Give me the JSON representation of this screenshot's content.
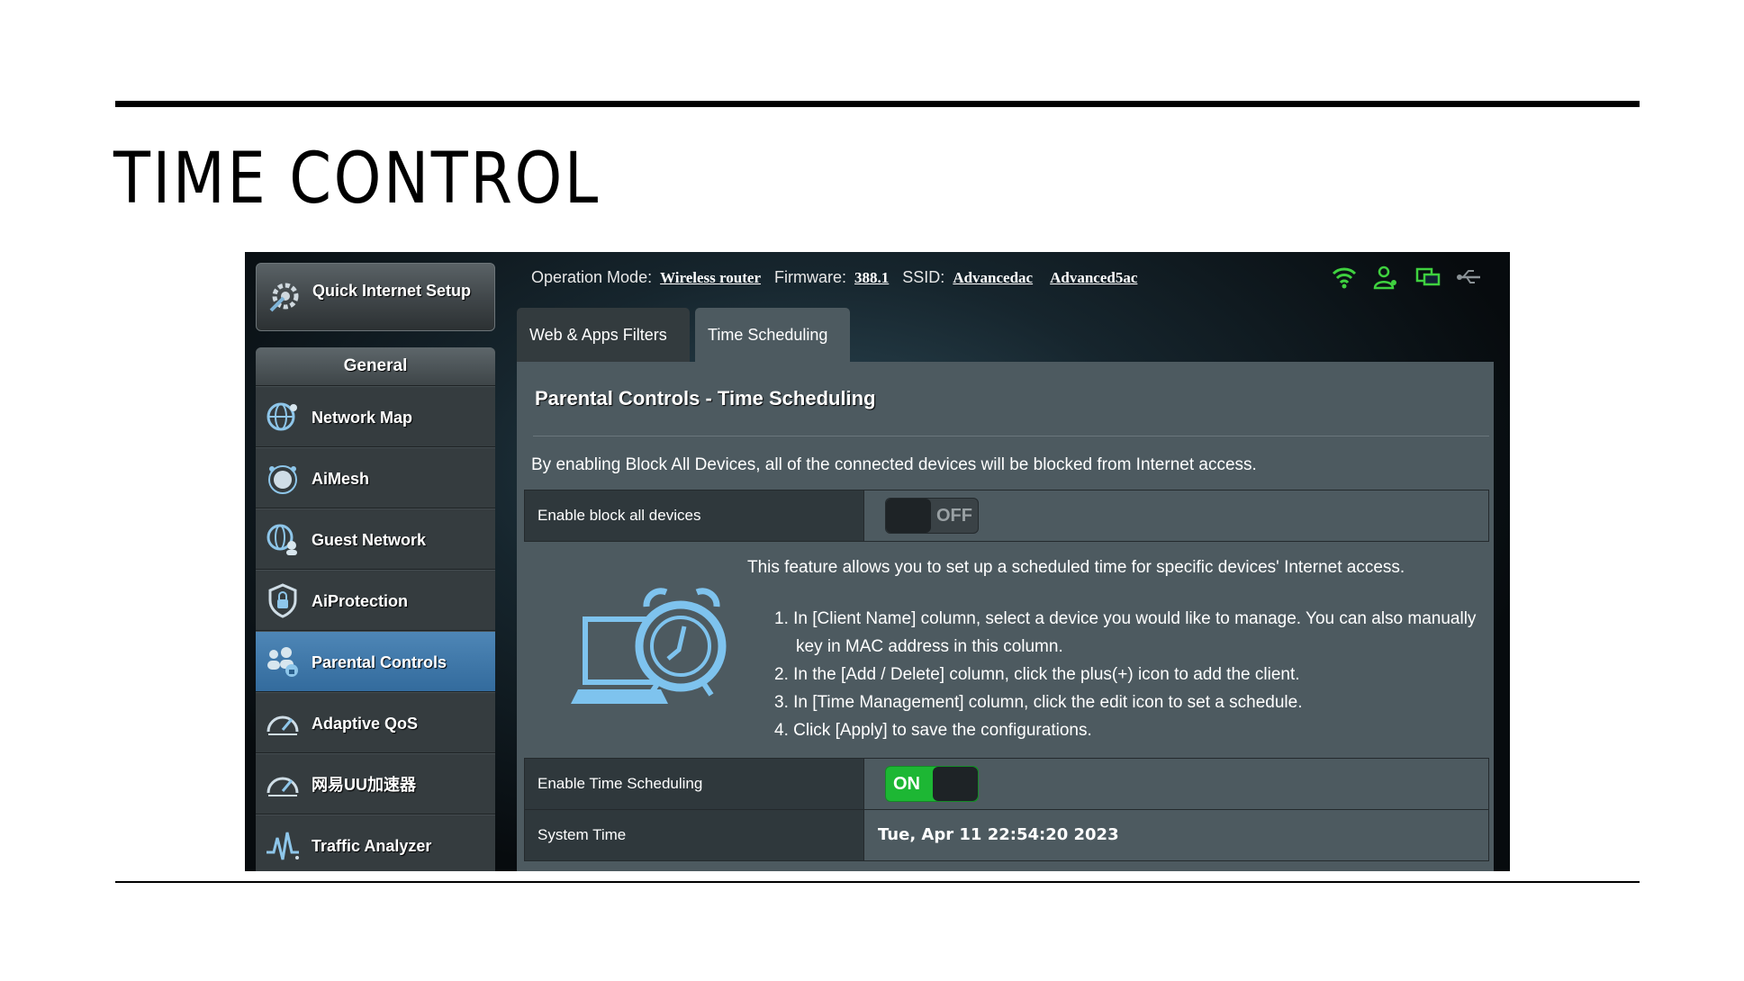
{
  "slide": {
    "title": "TIME CONTROL"
  },
  "sidebar": {
    "quick_setup": "Quick Internet Setup",
    "section": "General",
    "items": [
      {
        "label": "Network Map",
        "icon": "globe-network-icon"
      },
      {
        "label": "AiMesh",
        "icon": "aimesh-icon"
      },
      {
        "label": "Guest Network",
        "icon": "guest-network-icon"
      },
      {
        "label": "AiProtection",
        "icon": "shield-lock-icon"
      },
      {
        "label": "Parental Controls",
        "icon": "family-lock-icon",
        "active": true
      },
      {
        "label": "Adaptive QoS",
        "icon": "speedometer-icon"
      },
      {
        "label": "网易UU加速器",
        "icon": "speedometer-icon"
      },
      {
        "label": "Traffic Analyzer",
        "icon": "traffic-analyzer-icon"
      }
    ]
  },
  "topbar": {
    "op_mode_label": "Operation Mode:",
    "op_mode_value": "Wireless router",
    "firmware_label": "Firmware:",
    "firmware_value": "388.1",
    "ssid_label": "SSID:",
    "ssid_1": "Advancedac",
    "ssid_2": "Advanced5ac",
    "status_icons": [
      "wifi-icon",
      "users-icon",
      "devices-icon",
      "usb-icon"
    ],
    "status_color": "#3fd13f"
  },
  "tabs": [
    {
      "label": "Web & Apps Filters"
    },
    {
      "label": "Time Scheduling",
      "active": true
    }
  ],
  "panel": {
    "title": "Parental Controls - Time Scheduling",
    "description": "By enabling Block All Devices, all of the connected devices will be blocked from Internet access.",
    "block_all_label": "Enable block all devices",
    "block_all_state": "OFF",
    "feature_text": "This feature allows you to set up a scheduled time for specific devices' Internet access.",
    "steps": [
      "1. In [Client Name] column, select a device you would like to manage. You can also manually key in MAC address in this column.",
      "2. In the [Add / Delete] column, click the plus(+) icon to add the client.",
      "3. In [Time Management] column, click the edit icon to set a schedule.",
      "4. Click [Apply] to save the configurations."
    ],
    "time_sched_label": "Enable Time Scheduling",
    "time_sched_state": "ON",
    "system_time_label": "System Time",
    "system_time_value": "Tue, Apr 11 22:54:20 2023"
  },
  "colors": {
    "accent_active": "#3f79ab",
    "toggle_on": "#1db734",
    "panel_bg": "#4d5a60"
  }
}
